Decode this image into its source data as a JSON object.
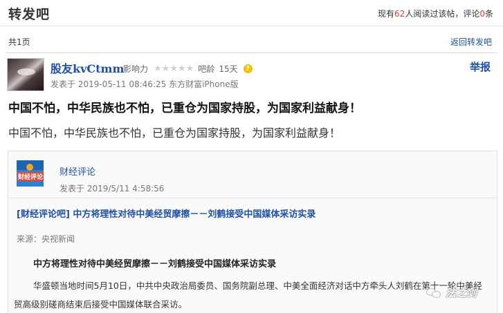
{
  "header": {
    "forum_title": "转发吧",
    "readers_prefix": "现有",
    "readers_count": "62",
    "readers_mid": "人阅读过该帖，评论",
    "comments_count": "0",
    "comments_suffix": "条"
  },
  "pager": {
    "page_count": "共1页",
    "back_link": "返回转发吧"
  },
  "post": {
    "username": "股友kvCtmm",
    "influence_label": "影响力",
    "stars": "★★★★★",
    "star_rating": 0,
    "age_label": "吧龄",
    "age_value": "15天",
    "help_icon": "?",
    "report_link": "举报",
    "meta": "发表于 2019-05-11 08:46:25 东方财富iPhone版",
    "title": "中国不怕，中华民族也不怕，已重仓为国家持股，为国家利益献身！",
    "body": "中国不怕，中华民族也不怕，已重仓为国家持股，为国家利益献身！"
  },
  "quote": {
    "logo_text": "财经评论",
    "author": "财经评论",
    "time": "发表于 2019/5/11 4:58:56",
    "headline": "[财经评论吧] 中方将理性对待中美经贸摩擦－－刘鹤接受中国媒体采访实录",
    "source": "来源：央视新闻",
    "article_title": "中方将理性对待中美经贸摩擦－－刘鹤接受中国媒体采访实录",
    "article_body": "华盛顿当地时间5月10日，中共中央政治局委员、国务院副总理、中美全面经济对话中方牵头人刘鹤在第十一轮中美经贸高级别磋商结束后接受中国媒体联合采访。"
  },
  "watermark": {
    "icon": "wechat-icon",
    "text": "法之剑"
  },
  "colors": {
    "link_blue": "#1e50a2",
    "highlight_red": "#e4393c",
    "star_gray": "#cfcfcf"
  }
}
